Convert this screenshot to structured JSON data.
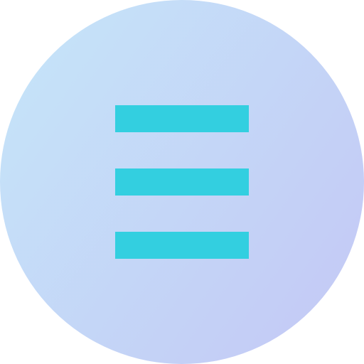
{
  "icon": {
    "name": "hamburger-menu-icon",
    "bar_count": 3
  },
  "colors": {
    "circle_gradient_start": "#c5e4f9",
    "circle_gradient_end": "#c4c9f5",
    "bar": "#33cfe0"
  }
}
